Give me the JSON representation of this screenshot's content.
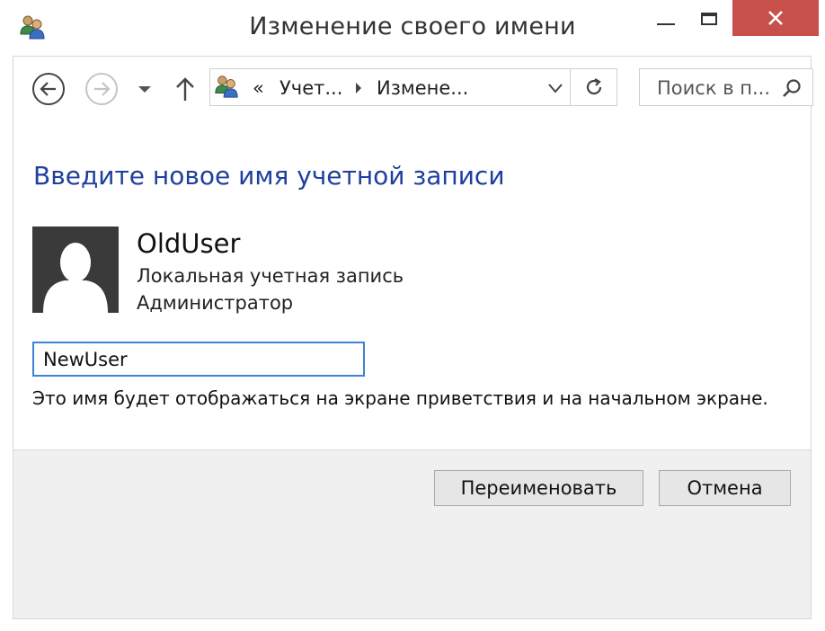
{
  "window": {
    "title": "Изменение своего имени",
    "close_bg": "#c7504a"
  },
  "nav": {
    "back_icon": "back-arrow-icon",
    "forward_icon": "forward-arrow-icon",
    "up_icon": "up-arrow-icon"
  },
  "address": {
    "chevron": "«",
    "segment1": "Учет...",
    "segment2": "Измене..."
  },
  "search": {
    "placeholder": "Поиск в п..."
  },
  "main": {
    "heading": "Введите новое имя учетной записи",
    "heading_color": "#1e3f9e",
    "user": {
      "name": "OldUser",
      "account_type": "Локальная учетная запись",
      "role": "Администратор"
    },
    "new_name_value": "NewUser",
    "hint": "Это имя будет отображаться на экране приветствия и на начальном экране."
  },
  "buttons": {
    "rename": "Переименовать",
    "cancel": "Отмена"
  }
}
